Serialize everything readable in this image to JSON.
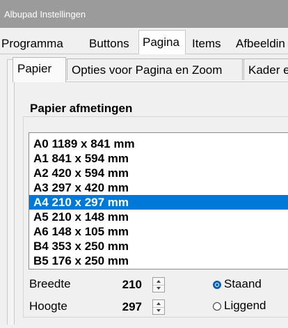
{
  "window": {
    "title": "Albupad Instellingen"
  },
  "main_tabs": [
    {
      "label": "Programma"
    },
    {
      "label": "Buttons"
    },
    {
      "label": "Pagina",
      "active": true
    },
    {
      "label": "Items"
    },
    {
      "label": "Afbeeldin"
    }
  ],
  "sub_tabs": [
    {
      "label": "Papier",
      "active": true
    },
    {
      "label": "Opties voor Pagina en Zoom"
    },
    {
      "label": "Kader e"
    }
  ],
  "paper_group": {
    "title": "Papier afmetingen",
    "sizes": [
      "A0  1189 x 841 mm",
      "A1  841 x 594 mm",
      "A2  420 x 594 mm",
      "A3  297 x 420 mm",
      "A4  210 x 297 mm",
      "A5  210 x 148 mm",
      "A6  148 x 105 mm",
      "B4  353 x 250 mm",
      "B5  176 x 250 mm"
    ],
    "selected_size": "A4  210 x 297 mm",
    "width_label": "Breedte",
    "width_value": "210",
    "height_label": "Hoogte",
    "height_value": "297",
    "orientation_options": [
      "Staand",
      "Liggend"
    ],
    "orientation_selected": "Staand"
  },
  "colors": {
    "selection": "#0078d7",
    "titlebar": "#9b9b9b"
  }
}
